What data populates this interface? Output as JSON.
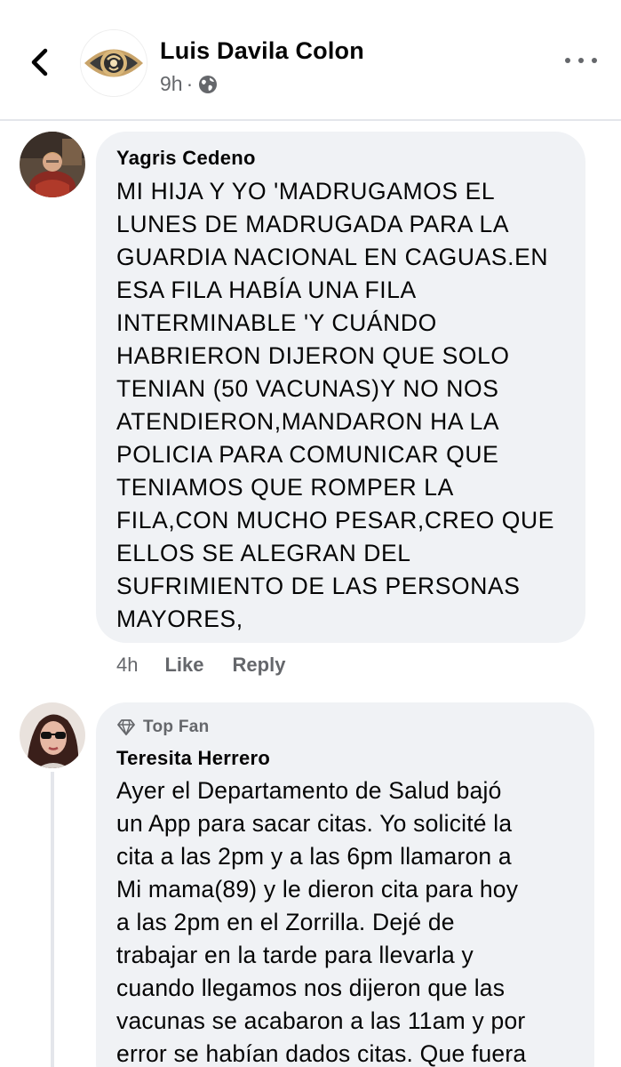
{
  "header": {
    "page_name": "Luis Davila Colon",
    "time": "9h",
    "separator": "·",
    "audience_icon": "globe-icon",
    "back_icon": "chevron-left-icon",
    "more_icon": "more-horizontal-icon"
  },
  "comments": [
    {
      "author": "Yagris Cedeno",
      "text": "MI HIJA Y YO 'MADRUGAMOS EL\nLUNES DE MADRUGADA PARA LA\nGUARDIA NACIONAL EN CAGUAS.EN\nESA FILA HABÍA UNA FILA\nINTERMINABLE 'Y CUÁNDO\nHABRIERON DIJERON QUE SOLO\nTENIAN (50 VACUNAS)Y NO NOS\nATENDIERON,MANDARON HA LA\nPOLICIA PARA COMUNICAR QUE\nTENIAMOS QUE ROMPER LA\nFILA,CON MUCHO PESAR,CREO QUE\nELLOS SE ALEGRAN DEL\nSUFRIMIENTO DE LAS PERSONAS\nMAYORES,",
      "time": "4h",
      "like_label": "Like",
      "reply_label": "Reply"
    },
    {
      "badge": "Top Fan",
      "badge_icon": "diamond-icon",
      "author": "Teresita Herrero",
      "text": "Ayer el Departamento de Salud bajó\nun App para sacar citas. Yo solicité la\ncita a las 2pm y a las 6pm llamaron a\nMi mama(89) y le dieron cita para hoy\na las 2pm en el Zorrilla. Dejé de\ntrabajar en la tarde para llevarla y\ncuando llegamos nos dijeron que las\nvacunas se acabaron a las 11am y por\nerror se habían dados citas. Que fuera"
    }
  ],
  "colors": {
    "bubble": "#f0f2f5",
    "meta_text": "#65676b",
    "primary_text": "#050505",
    "divider": "#e4e6eb",
    "logo_gold": "#b8965a",
    "logo_dark": "#3a3a3a"
  }
}
